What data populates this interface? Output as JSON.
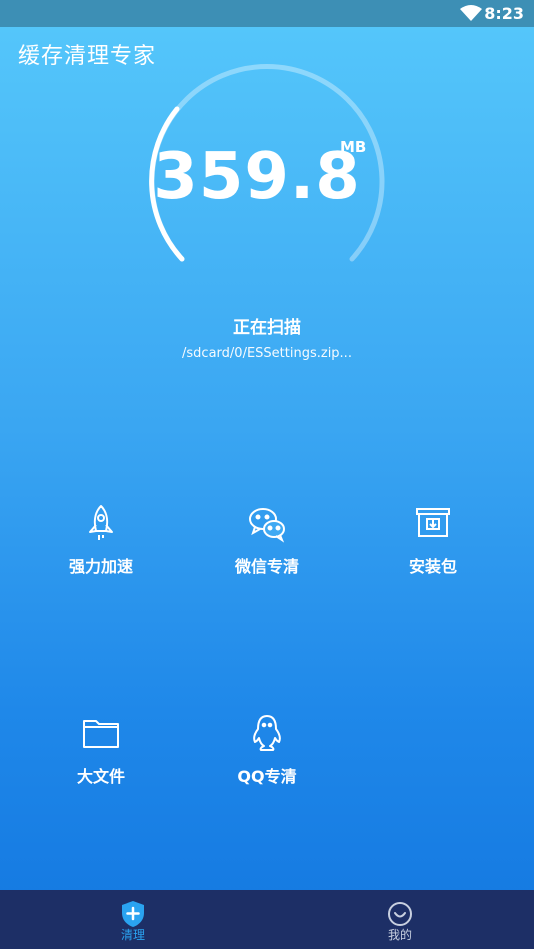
{
  "status_bar": {
    "time": "8:23",
    "icons": [
      "wifi-icon"
    ]
  },
  "app": {
    "title": "缓存清理专家"
  },
  "scan": {
    "size_value": "359.8",
    "size_unit": "MB",
    "status": "正在扫描",
    "current_path": "/sdcard/0/ESSettings.zip..."
  },
  "features": [
    {
      "label": "强力加速",
      "icon": "rocket-icon"
    },
    {
      "label": "微信专清",
      "icon": "wechat-icon"
    },
    {
      "label": "安装包",
      "icon": "archive-box-icon"
    },
    {
      "label": "大文件",
      "icon": "folder-icon"
    },
    {
      "label": "QQ专清",
      "icon": "qq-penguin-icon"
    }
  ],
  "bottom_nav": [
    {
      "label": "清理",
      "icon": "shield-plus-icon",
      "active": true
    },
    {
      "label": "我的",
      "icon": "smiley-icon",
      "active": false
    }
  ],
  "colors": {
    "background_top": "#56c8fb",
    "background_bottom": "#1377e0",
    "status_bar": "#3d8fb5",
    "nav_bar": "#1d2f66",
    "nav_active": "#2aa3f0",
    "nav_inactive": "#c8d0e0"
  }
}
